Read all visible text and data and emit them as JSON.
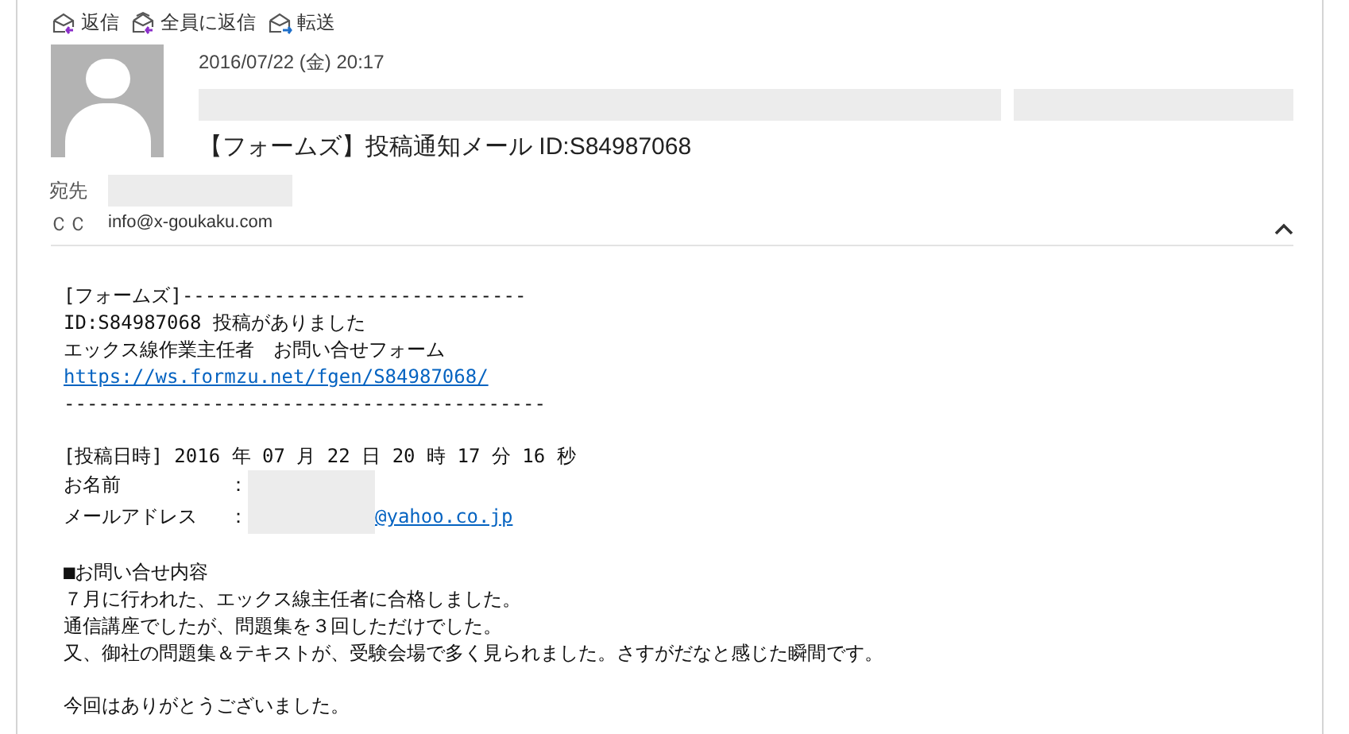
{
  "toolbar": [
    {
      "label": "返信",
      "kind": "reply"
    },
    {
      "label": "全員に返信",
      "kind": "reply_all"
    },
    {
      "label": "転送",
      "kind": "forward"
    }
  ],
  "header": {
    "date": "2016/07/22 (金) 20:17",
    "subject": "【フォームズ】投稿通知メール ID:S84987068",
    "to_label": "宛先",
    "cc_label": "ＣＣ",
    "cc": "info@x-goukaku.com",
    "expanded": true
  },
  "body": [
    [
      {
        "kind": "text",
        "text": "[フォームズ]------------------------------"
      },
      {
        "kind": "text",
        "text": "ID:S84987068 投稿がありました"
      },
      {
        "kind": "text",
        "text": "エックス線作業主任者　お問い合せフォーム"
      },
      {
        "kind": "link",
        "text": "https://ws.formzu.net/fgen/S84987068/"
      },
      {
        "kind": "text",
        "text": "------------------------------------------"
      }
    ],
    [
      {
        "kind": "text",
        "text": "[投稿日時] 2016 年 07 月 22 日 20 時 17 分 16 秒"
      },
      {
        "kind": "field",
        "label": "お名前",
        "colon": "："
      },
      {
        "kind": "field",
        "label": "メールアドレス",
        "colon": "：",
        "value": "@yahoo.co.jp"
      }
    ],
    [
      {
        "kind": "text",
        "text": "■お問い合せ内容"
      },
      {
        "kind": "text",
        "text": "７月に行われた、エックス線主任者に合格しました。"
      },
      {
        "kind": "text",
        "text": "通信講座でしたが、問題集を３回しただけでした。"
      },
      {
        "kind": "text",
        "text": "又、御社の問題集＆テキストが、受験会場で多く見られました。さすがだなと感じた瞬間です。"
      }
    ],
    [
      {
        "kind": "text",
        "text": "今回はありがとうございました。"
      }
    ]
  ]
}
